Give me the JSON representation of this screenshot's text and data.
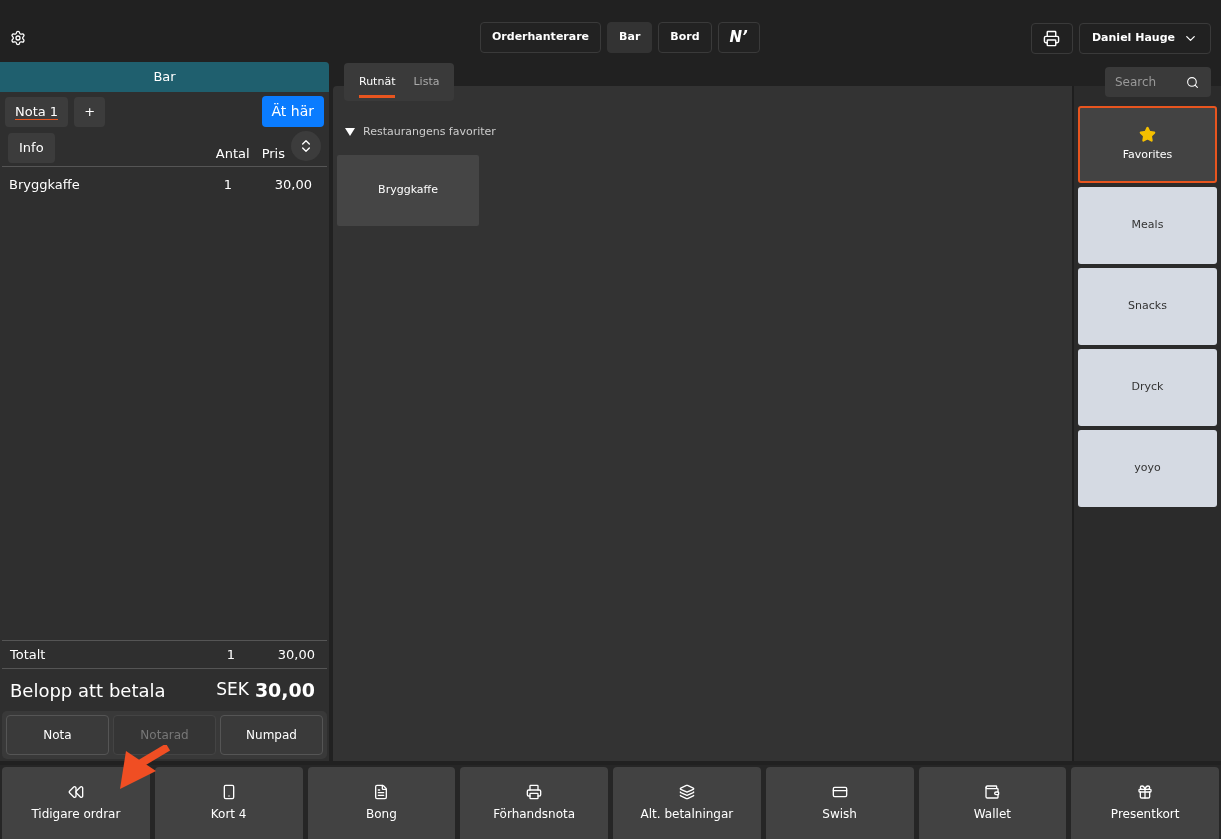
{
  "top_bar": {
    "nav_buttons": [
      {
        "label": "Orderhanterare",
        "selected": false,
        "kind": "text"
      },
      {
        "label": "Bar",
        "selected": true,
        "kind": "text"
      },
      {
        "label": "Bord",
        "selected": false,
        "kind": "text"
      },
      {
        "label": "N’",
        "selected": false,
        "kind": "logo"
      }
    ],
    "user": "Daniel Hauge"
  },
  "order": {
    "title": "Bar",
    "notes": [
      {
        "label": "Nota 1",
        "selected": true
      }
    ],
    "add_label": "+",
    "dine_option": "Ät här",
    "info_label": "Info",
    "columns": [
      "Antal",
      "Pris"
    ],
    "items": [
      {
        "name": "Bryggkaffe",
        "qty": "1",
        "price": "30,00"
      }
    ],
    "total": {
      "label": "Totalt",
      "qty": "1",
      "price": "30,00"
    },
    "amount_due": {
      "label": "Belopp att betala",
      "currency": "SEK",
      "value": "30,00"
    },
    "actions": [
      {
        "label": "Nota",
        "disabled": false
      },
      {
        "label": "Notarad",
        "disabled": true
      },
      {
        "label": "Numpad",
        "disabled": false
      }
    ]
  },
  "catalog": {
    "view_tabs": [
      {
        "label": "Rutnät",
        "selected": true
      },
      {
        "label": "Lista",
        "selected": false
      }
    ],
    "section": {
      "title": "Restaurangens favoriter",
      "expanded": true,
      "products": [
        "Bryggkaffe"
      ]
    }
  },
  "search": {
    "placeholder": "Search"
  },
  "categories": [
    {
      "label": "Favorites",
      "selected": true,
      "kind": "favorites"
    },
    {
      "label": "Meals",
      "selected": false,
      "kind": "plain"
    },
    {
      "label": "Snacks",
      "selected": false,
      "kind": "plain"
    },
    {
      "label": "Dryck",
      "selected": false,
      "kind": "plain"
    },
    {
      "label": "yoyo",
      "selected": false,
      "kind": "plain"
    }
  ],
  "bottom_actions": [
    "Tidigare ordrar",
    "Kort 4",
    "Bong",
    "Förhandsnota",
    "Alt. betalningar",
    "Swish",
    "Wallet",
    "Presentkort"
  ]
}
